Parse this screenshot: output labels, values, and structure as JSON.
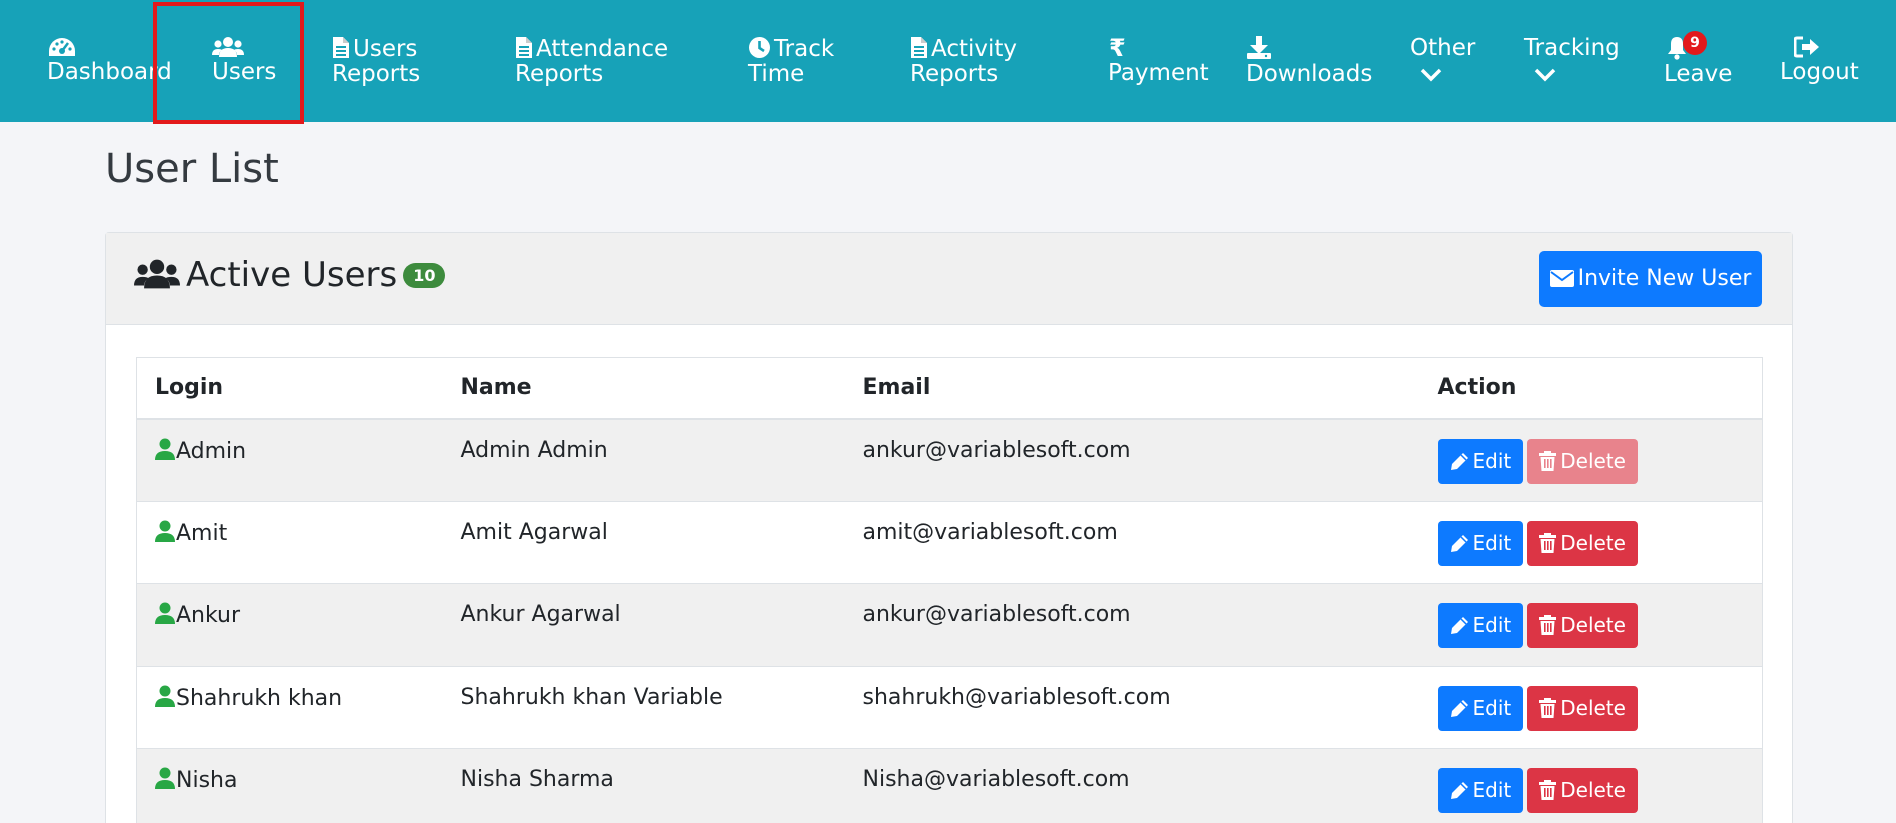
{
  "nav": {
    "dashboard": "Dashboard",
    "users": "Users",
    "users_reports_1": "Users",
    "users_reports_2": "Reports",
    "attendance_1": "Attendance",
    "attendance_2": "Reports",
    "track_1": "Track",
    "track_2": "Time",
    "activity_1": "Activity",
    "activity_2": "Reports",
    "payment": "Payment",
    "downloads": "Downloads",
    "other": "Other",
    "tracking": "Tracking",
    "leave": "Leave",
    "leave_badge": "9",
    "logout": "Logout"
  },
  "page": {
    "title": "User List"
  },
  "card": {
    "title": "Active Users",
    "count": "10",
    "invite_label": "Invite New User"
  },
  "table": {
    "headers": {
      "login": "Login",
      "name": "Name",
      "email": "Email",
      "action": "Action"
    },
    "edit_label": "Edit",
    "delete_label": "Delete",
    "rows": [
      {
        "login": "Admin",
        "name": "Admin Admin",
        "email": "ankur@variablesoft.com",
        "delete_disabled": true
      },
      {
        "login": "Amit",
        "name": "Amit Agarwal",
        "email": "amit@variablesoft.com",
        "delete_disabled": false
      },
      {
        "login": "Ankur",
        "name": "Ankur Agarwal",
        "email": "ankur@variablesoft.com",
        "delete_disabled": false
      },
      {
        "login": "Shahrukh khan",
        "name": "Shahrukh khan Variable",
        "email": "shahrukh@variablesoft.com",
        "delete_disabled": false
      },
      {
        "login": "Nisha",
        "name": "Nisha Sharma",
        "email": "Nisha@variablesoft.com",
        "delete_disabled": false
      }
    ]
  },
  "colors": {
    "navbar": "#17a2b8",
    "highlight": "#e3191b",
    "primary": "#0d7aff",
    "danger": "#dc3545",
    "success": "#3d8b3d"
  },
  "icons": [
    "tachometer-icon",
    "users-icon",
    "file-icon",
    "clock-icon",
    "rupee-icon",
    "download-icon",
    "chevron-down-icon",
    "bell-icon",
    "sign-out-icon",
    "envelope-icon",
    "user-icon",
    "pencil-icon",
    "trash-icon"
  ]
}
